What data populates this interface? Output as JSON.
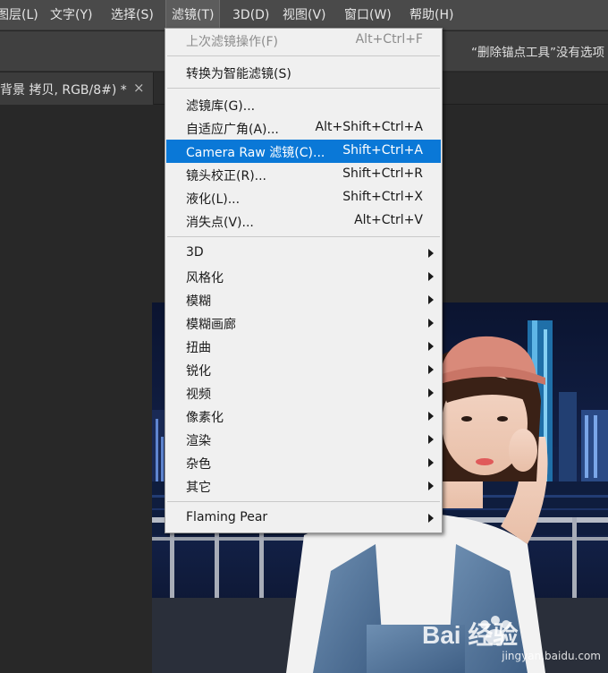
{
  "menubar": {
    "items": [
      "图层(L)",
      "文字(Y)",
      "选择(S)",
      "滤镜(T)",
      "3D(D)",
      "视图(V)",
      "窗口(W)",
      "帮助(H)"
    ],
    "active_index": 3
  },
  "options_bar": {
    "hint": "“删除锚点工具”没有选项"
  },
  "document_tab": {
    "title": "背景 拷贝, RGB/8#) *",
    "close": "×"
  },
  "filter_menu": {
    "groups": [
      [
        {
          "label": "上次滤镜操作(F)",
          "shortcut": "Alt+Ctrl+F",
          "disabled": true
        }
      ],
      [
        {
          "label": "转换为智能滤镜(S)",
          "shortcut": ""
        }
      ],
      [
        {
          "label": "滤镜库(G)...",
          "shortcut": ""
        },
        {
          "label": "自适应广角(A)...",
          "shortcut": "Alt+Shift+Ctrl+A"
        },
        {
          "label": "Camera Raw 滤镜(C)...",
          "shortcut": "Shift+Ctrl+A",
          "highlighted": true
        },
        {
          "label": "镜头校正(R)...",
          "shortcut": "Shift+Ctrl+R"
        },
        {
          "label": "液化(L)...",
          "shortcut": "Shift+Ctrl+X"
        },
        {
          "label": "消失点(V)...",
          "shortcut": "Alt+Ctrl+V"
        }
      ],
      [
        {
          "label": "3D",
          "submenu": true
        },
        {
          "label": "风格化",
          "submenu": true
        },
        {
          "label": "模糊",
          "submenu": true
        },
        {
          "label": "模糊画廊",
          "submenu": true
        },
        {
          "label": "扭曲",
          "submenu": true
        },
        {
          "label": "锐化",
          "submenu": true
        },
        {
          "label": "视频",
          "submenu": true
        },
        {
          "label": "像素化",
          "submenu": true
        },
        {
          "label": "渲染",
          "submenu": true
        },
        {
          "label": "杂色",
          "submenu": true
        },
        {
          "label": "其它",
          "submenu": true
        }
      ],
      [
        {
          "label": "Flaming Pear",
          "submenu": true
        }
      ]
    ]
  },
  "watermark": {
    "text": "Bai   经验",
    "sub": "jingyan.baidu.com"
  },
  "colors": {
    "menubar_bg": "#4a4a4a",
    "menu_bg": "#f0f0f0",
    "highlight": "#0a78d7"
  }
}
